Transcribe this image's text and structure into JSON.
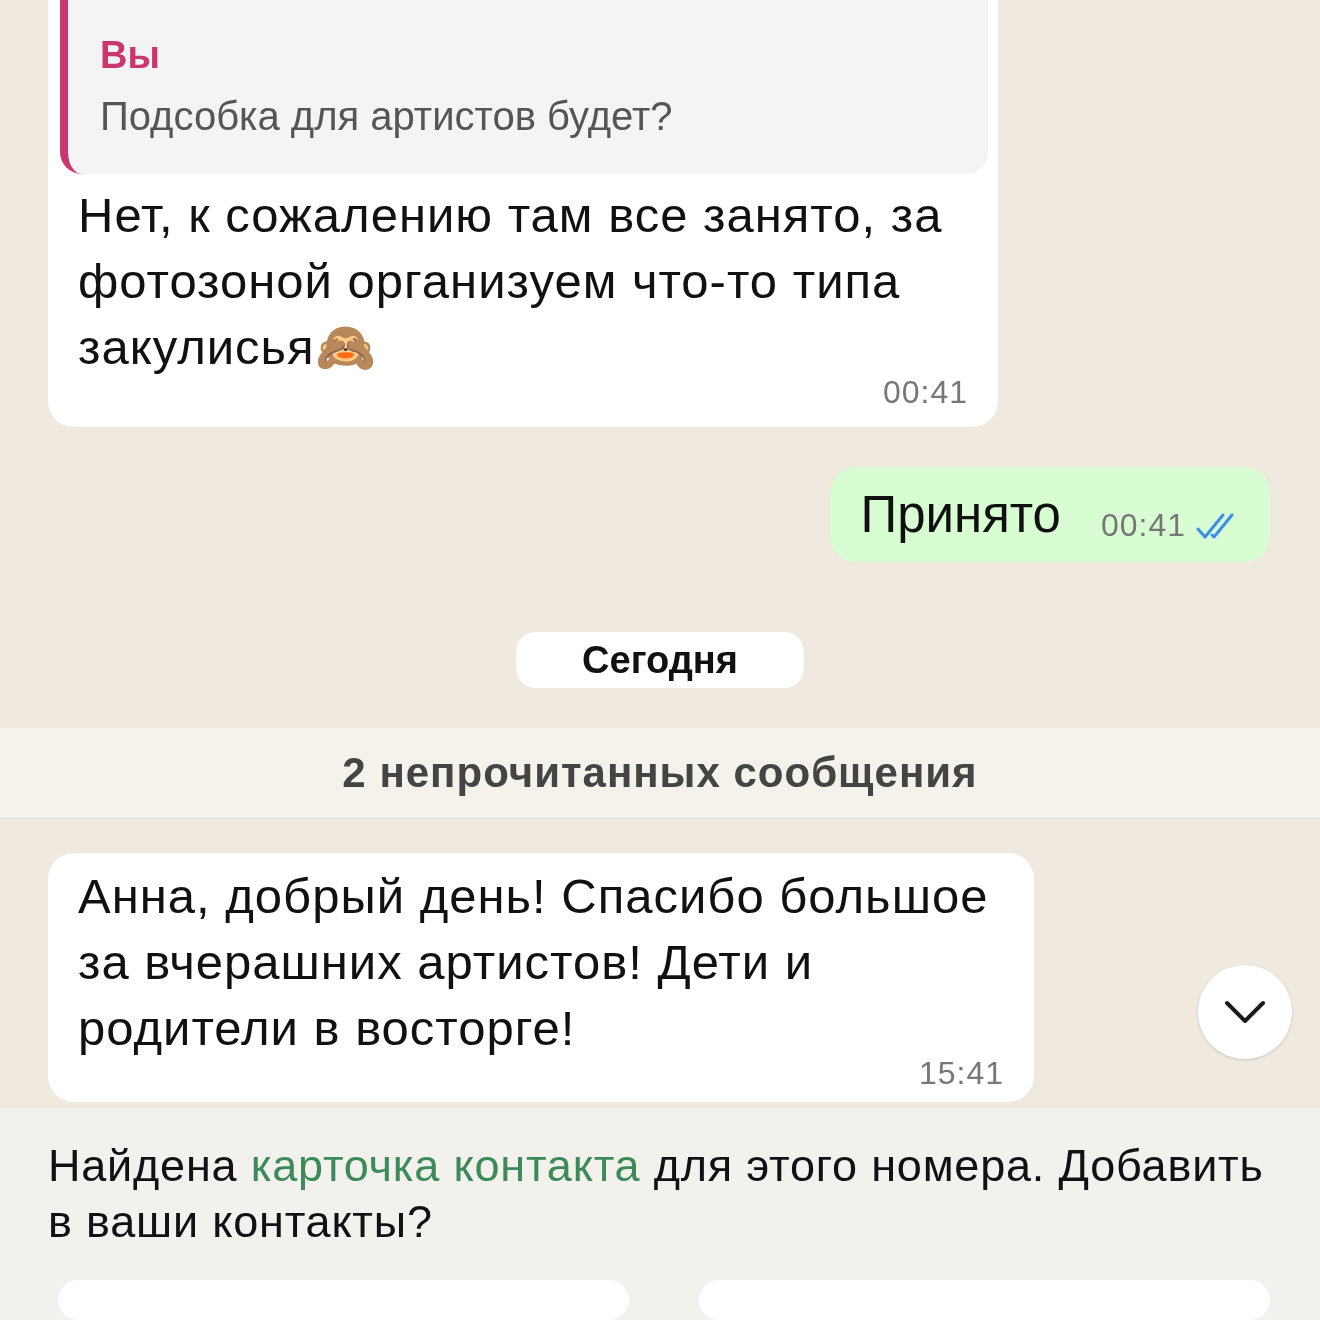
{
  "messages": [
    {
      "kind": "incoming",
      "quote": {
        "author": "Вы",
        "text": "Подсобка для артистов будет?"
      },
      "text": "Нет, к сожалению там все занято, за фотозоной организуем что-то типа закулисья🙈",
      "time": "00:41"
    },
    {
      "kind": "outgoing",
      "text": "Принято",
      "time": "00:41",
      "read": true
    },
    {
      "kind": "date",
      "text": "Сегодня"
    },
    {
      "kind": "unread",
      "text": "2 непрочитанных сообщения"
    },
    {
      "kind": "incoming",
      "text": "Анна, добрый день! Спасибо большое за вчерашних артистов! Дети и родители в восторге!",
      "time": "15:41"
    }
  ],
  "scroll_down_button": true,
  "contact_notice": {
    "text": "Найдена **карточка контакта** для этого номера. Добавить в ваши контакты?"
  },
  "actions": [
    {
      "kind": "button"
    },
    {
      "kind": "button"
    }
  ]
}
